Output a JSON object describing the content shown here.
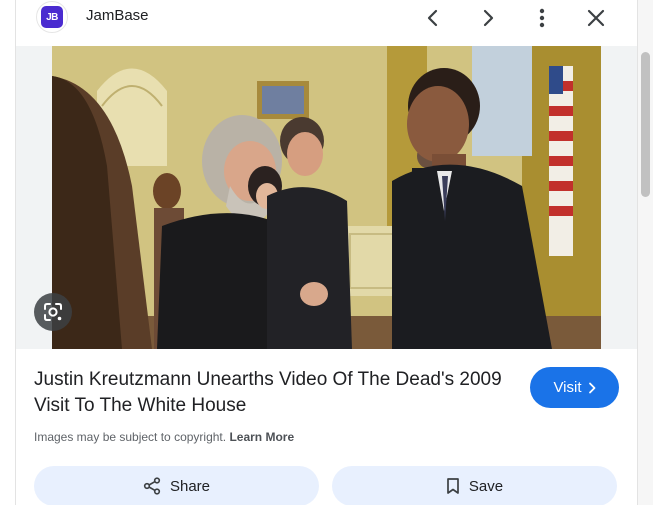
{
  "header": {
    "site_name": "JamBase",
    "logo_text": "JB",
    "logo_color": "#4a2bd0",
    "icons": [
      "chevron-left-icon",
      "chevron-right-icon",
      "more-vert-icon",
      "close-icon"
    ]
  },
  "image": {
    "lens_icon": "google-lens-icon"
  },
  "result": {
    "title": "Justin Kreutzmann Unearths Video Of The Dead's 2009 Visit To The White House",
    "visit_label": "Visit",
    "copyright_text": "Images may be subject to copyright.",
    "learn_more_label": "Learn More"
  },
  "actions": {
    "share_label": "Share",
    "save_label": "Save"
  },
  "colors": {
    "accent": "#1a73e8",
    "pill_bg": "#e8f0fe"
  }
}
